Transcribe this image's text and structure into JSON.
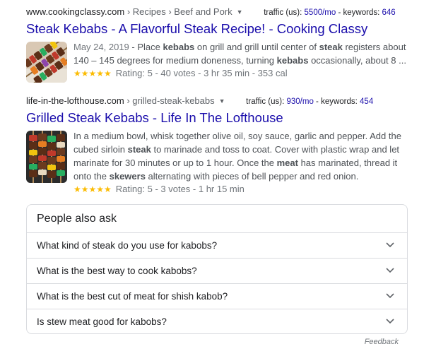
{
  "results": [
    {
      "url_host": "www.cookingclassy.com",
      "url_crumbs": " › Recipes › Beef and Pork",
      "traffic_label": "traffic (us): ",
      "traffic_value": "5500/mo",
      "keywords_label": " - keywords: ",
      "keywords_value": "646",
      "title": "Steak Kebabs - A Flavorful Steak Recipe! - Cooking Classy",
      "snippet": {
        "date": "May 24, 2019",
        "parts": [
          " - Place ",
          "kebabs",
          " on grill and grill until center of ",
          "steak",
          " registers about 140 – 145 degrees for medium doneness, turning ",
          "kebabs",
          " occasionally, about 8 ..."
        ]
      },
      "stars": "★★★★★",
      "rating_text": "Rating: 5 - 40 votes - 3 hr 35 min - 353 cal",
      "thumbnail_icon": "kebab-photo"
    },
    {
      "url_host": "life-in-the-lofthouse.com",
      "url_crumbs": " › grilled-steak-kebabs",
      "traffic_label": "traffic (us): ",
      "traffic_value": "930/mo",
      "keywords_label": " - keywords: ",
      "keywords_value": "454",
      "title": "Grilled Steak Kebabs - Life In The Lofthouse",
      "snippet": {
        "parts": [
          "In a medium bowl, whisk together olive oil, soy sauce, garlic and pepper. Add the cubed sirloin ",
          "steak",
          " to marinade and toss to coat. Cover with plastic wrap and let marinate for 30 minutes or up to 1 hour. Once the ",
          "meat",
          " has marinated, thread it onto the ",
          "skewers",
          " alternating with pieces of bell pepper and red onion."
        ]
      },
      "stars": "★★★★★",
      "rating_text": "Rating: 5 - 3 votes - 1 hr 15 min",
      "thumbnail_icon": "skewers-photo"
    }
  ],
  "people_also_ask": {
    "title": "People also ask",
    "questions": [
      "What kind of steak do you use for kabobs?",
      "What is the best way to cook kabobs?",
      "What is the best cut of meat for shish kabob?",
      "Is stew meat good for kabobs?"
    ]
  },
  "feedback_label": "Feedback",
  "colors": {
    "link": "#1a0dab",
    "star": "#fbbc04",
    "snippet": "#4d5156",
    "border": "#dadce0"
  }
}
